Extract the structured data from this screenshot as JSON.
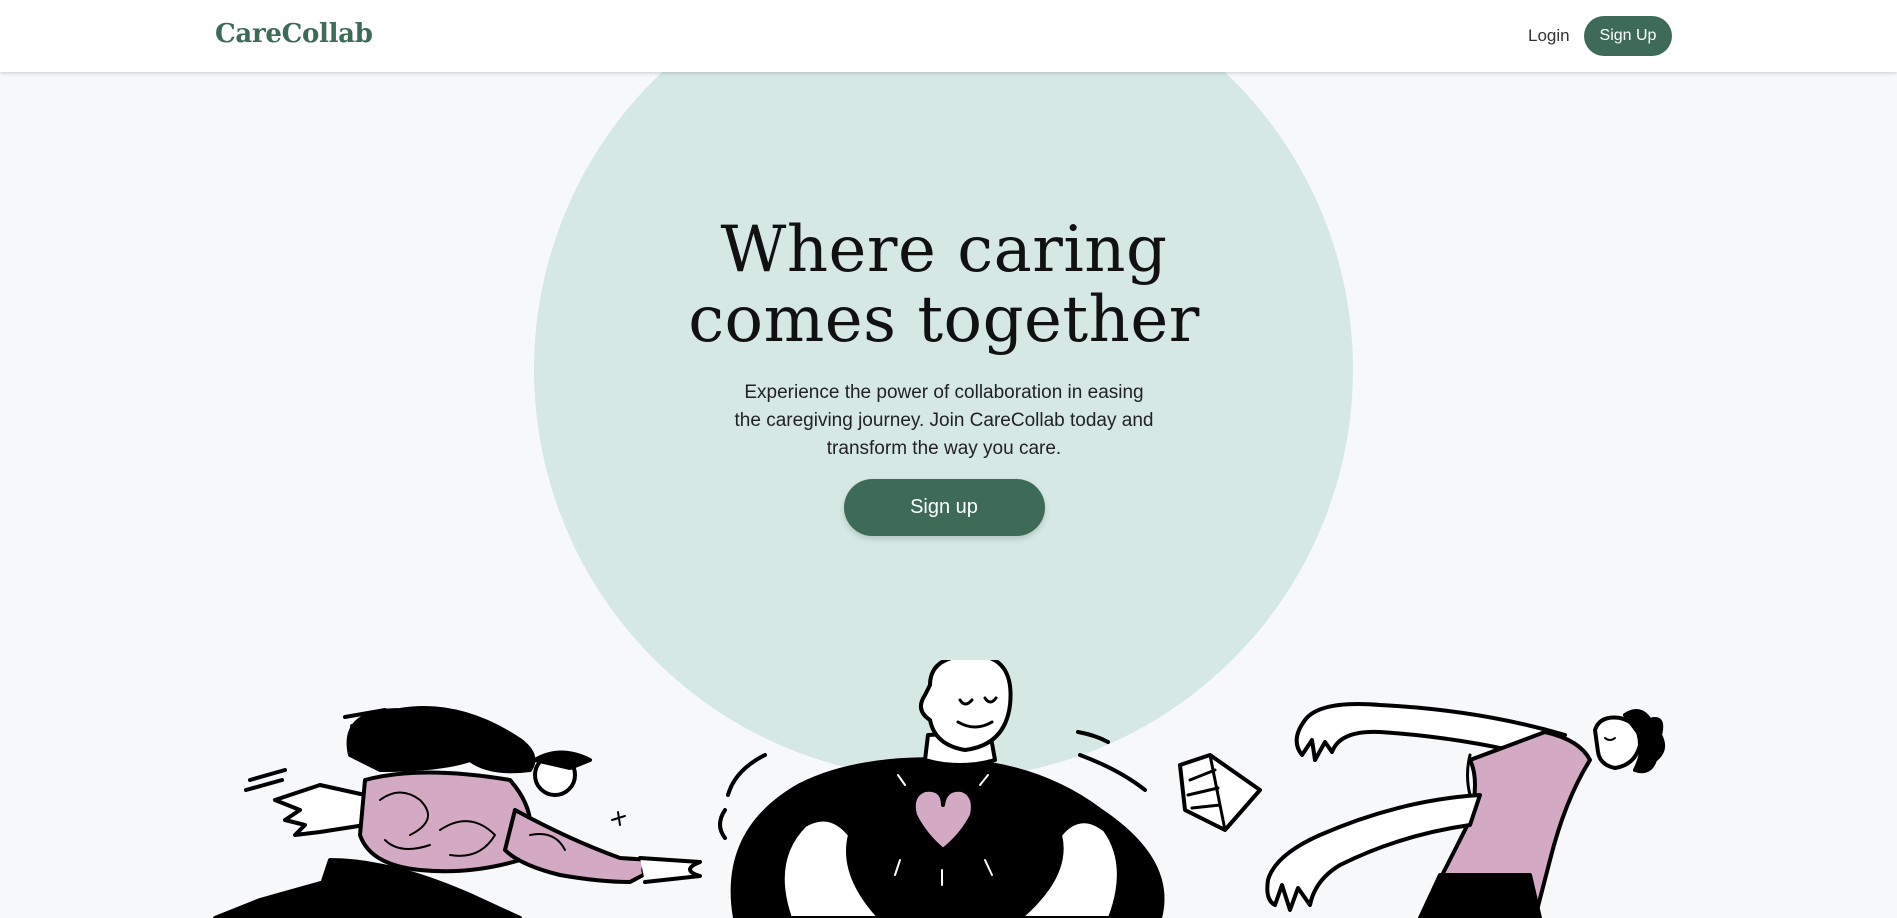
{
  "navbar": {
    "brand": "CareCollab",
    "login_label": "Login",
    "signup_label": "Sign Up"
  },
  "hero": {
    "title_line1": "Where caring",
    "title_line2": "comes together",
    "subtitle": "Experience the power of collaboration in easing the caregiving journey. Join CareCollab today and transform the way you care.",
    "cta_label": "Sign up"
  },
  "illustration": {
    "figures": [
      "running-person-illustration",
      "person-with-heart-illustration",
      "leaning-person-illustration"
    ]
  },
  "colors": {
    "brand_green": "#3d6b58",
    "circle_mint": "#d5e8e3",
    "accent_pink": "#d4a9c4",
    "background": "#f7f8fa"
  }
}
